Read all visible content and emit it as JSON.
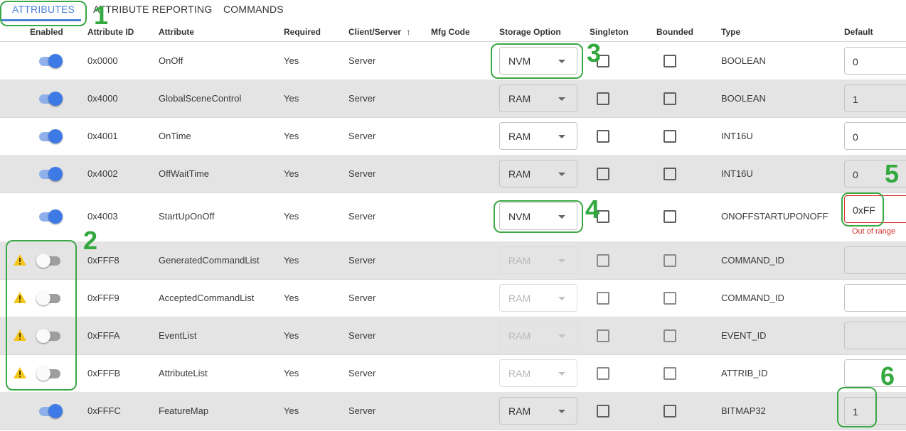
{
  "tabs": [
    {
      "label": "ATTRIBUTES",
      "active": true
    },
    {
      "label": "ATTRIBUTE REPORTING",
      "active": false
    },
    {
      "label": "COMMANDS",
      "active": false
    }
  ],
  "columns": {
    "enabled": "Enabled",
    "attribute_id": "Attribute ID",
    "attribute": "Attribute",
    "required": "Required",
    "client_server": "Client/Server",
    "sort_icon": "↑",
    "mfg_code": "Mfg Code",
    "storage_option": "Storage Option",
    "singleton": "Singleton",
    "bounded": "Bounded",
    "type": "Type",
    "default": "Default"
  },
  "rows": [
    {
      "enabled": true,
      "warning": false,
      "id": "0x0000",
      "attribute": "OnOff",
      "required": "Yes",
      "side": "Server",
      "mfg_code": "",
      "storage": "NVM",
      "storage_disabled": false,
      "type": "BOOLEAN",
      "default": "0"
    },
    {
      "enabled": true,
      "warning": false,
      "id": "0x4000",
      "attribute": "GlobalSceneControl",
      "required": "Yes",
      "side": "Server",
      "mfg_code": "",
      "storage": "RAM",
      "storage_disabled": false,
      "type": "BOOLEAN",
      "default": "1"
    },
    {
      "enabled": true,
      "warning": false,
      "id": "0x4001",
      "attribute": "OnTime",
      "required": "Yes",
      "side": "Server",
      "mfg_code": "",
      "storage": "RAM",
      "storage_disabled": false,
      "type": "INT16U",
      "default": "0"
    },
    {
      "enabled": true,
      "warning": false,
      "id": "0x4002",
      "attribute": "OffWaitTime",
      "required": "Yes",
      "side": "Server",
      "mfg_code": "",
      "storage": "RAM",
      "storage_disabled": false,
      "type": "INT16U",
      "default": "0"
    },
    {
      "enabled": true,
      "warning": false,
      "id": "0x4003",
      "attribute": "StartUpOnOff",
      "required": "Yes",
      "side": "Server",
      "mfg_code": "",
      "storage": "NVM",
      "storage_disabled": false,
      "type": "ONOFFSTARTUPONOFF",
      "default": "0xFF",
      "error": "Out of range"
    },
    {
      "enabled": false,
      "warning": true,
      "id": "0xFFF8",
      "attribute": "GeneratedCommandList",
      "required": "Yes",
      "side": "Server",
      "mfg_code": "",
      "storage": "RAM",
      "storage_disabled": true,
      "type": "COMMAND_ID",
      "default": ""
    },
    {
      "enabled": false,
      "warning": true,
      "id": "0xFFF9",
      "attribute": "AcceptedCommandList",
      "required": "Yes",
      "side": "Server",
      "mfg_code": "",
      "storage": "RAM",
      "storage_disabled": true,
      "type": "COMMAND_ID",
      "default": ""
    },
    {
      "enabled": false,
      "warning": true,
      "id": "0xFFFA",
      "attribute": "EventList",
      "required": "Yes",
      "side": "Server",
      "mfg_code": "",
      "storage": "RAM",
      "storage_disabled": true,
      "type": "EVENT_ID",
      "default": ""
    },
    {
      "enabled": false,
      "warning": true,
      "id": "0xFFFB",
      "attribute": "AttributeList",
      "required": "Yes",
      "side": "Server",
      "mfg_code": "",
      "storage": "RAM",
      "storage_disabled": true,
      "type": "ATTRIB_ID",
      "default": ""
    },
    {
      "enabled": true,
      "warning": false,
      "id": "0xFFFC",
      "attribute": "FeatureMap",
      "required": "Yes",
      "side": "Server",
      "mfg_code": "",
      "storage": "RAM",
      "storage_disabled": false,
      "type": "BITMAP32",
      "default": "1"
    }
  ],
  "annotations": {
    "n1": "1",
    "n2": "2",
    "n3": "3",
    "n4": "4",
    "n5": "5",
    "n6": "6"
  },
  "colors": {
    "accent": "#4a7fd6",
    "toggle_on": "#3d7ae6",
    "annotation": "#32a83e",
    "error": "#d32f2f",
    "warning": "#f5c518",
    "row_shade": "#e4e4e4"
  }
}
